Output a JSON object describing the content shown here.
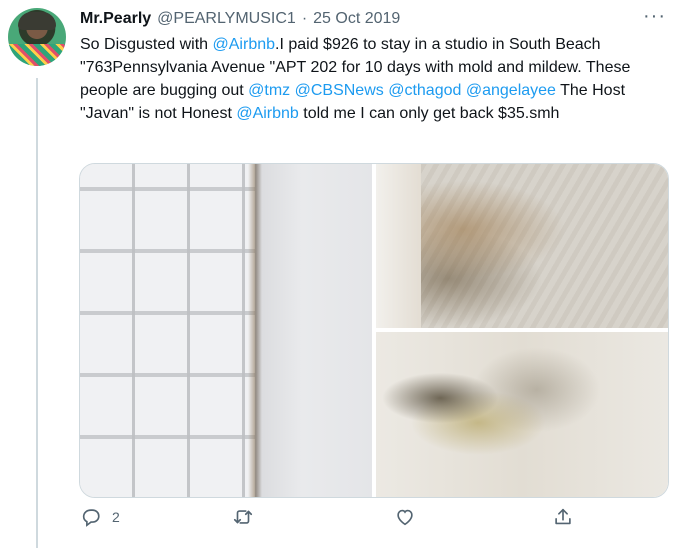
{
  "tweet": {
    "author_name": "Mr.Pearly",
    "author_handle": "@PEARLYMUSIC1",
    "separator": "·",
    "date": "25 Oct 2019",
    "more_label": "···",
    "text_segments": [
      {
        "text": "So Disgusted with ",
        "mention": false
      },
      {
        "text": "@Airbnb",
        "mention": true
      },
      {
        "text": ".I paid $926 to stay in a studio in South Beach \"763Pennsylvania Avenue \"APT 202 for 10 days with mold and mildew. These people are bugging out ",
        "mention": false
      },
      {
        "text": "@tmz",
        "mention": true
      },
      {
        "text": " ",
        "mention": false
      },
      {
        "text": "@CBSNews",
        "mention": true
      },
      {
        "text": " ",
        "mention": false
      },
      {
        "text": "@cthagod",
        "mention": true
      },
      {
        "text": " ",
        "mention": false
      },
      {
        "text": "@angelayee",
        "mention": true
      },
      {
        "text": " The Host \"Javan\" is not Honest ",
        "mention": false
      },
      {
        "text": "@Airbnb",
        "mention": true
      },
      {
        "text": " told me I can only get back $35.smh",
        "mention": false
      }
    ]
  },
  "actions": {
    "reply_icon": "reply-icon",
    "reply_count": "2",
    "retweet_icon": "retweet-icon",
    "like_icon": "like-icon",
    "share_icon": "share-icon"
  },
  "colors": {
    "mention": "#1d9bf0",
    "secondary_text": "#536471"
  }
}
